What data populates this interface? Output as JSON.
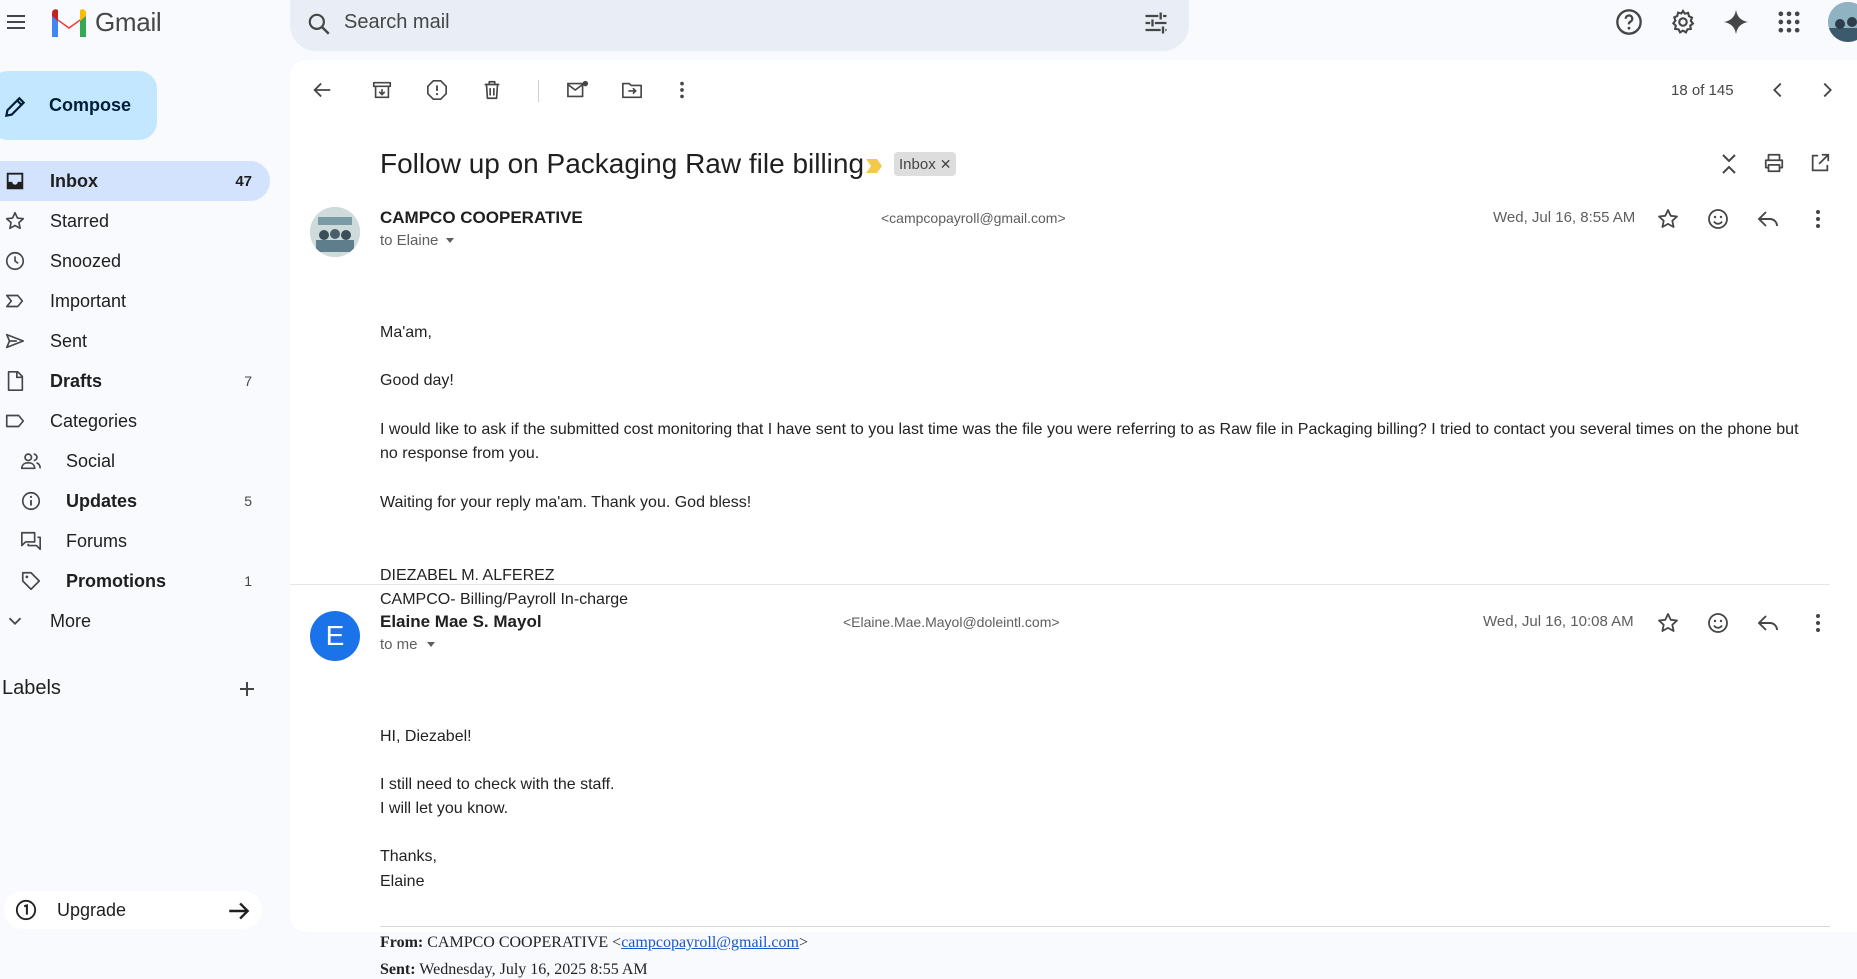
{
  "app": {
    "name": "Gmail"
  },
  "search": {
    "placeholder": "Search mail"
  },
  "sidebar": {
    "compose_label": "Compose",
    "items": [
      {
        "label": "Inbox",
        "count": "47"
      },
      {
        "label": "Starred",
        "count": ""
      },
      {
        "label": "Snoozed",
        "count": ""
      },
      {
        "label": "Important",
        "count": ""
      },
      {
        "label": "Sent",
        "count": ""
      },
      {
        "label": "Drafts",
        "count": "7"
      },
      {
        "label": "Categories",
        "count": ""
      },
      {
        "label": "Social",
        "count": ""
      },
      {
        "label": "Updates",
        "count": "5"
      },
      {
        "label": "Forums",
        "count": ""
      },
      {
        "label": "Promotions",
        "count": "1"
      },
      {
        "label": "More",
        "count": ""
      }
    ],
    "labels_title": "Labels",
    "upgrade_label": "Upgrade"
  },
  "toolbar": {
    "pager": "18 of 145"
  },
  "thread": {
    "subject": "Follow up on Packaging Raw file billing",
    "label_chip": "Inbox",
    "messages": [
      {
        "sender_name": "CAMPCO COOPERATIVE",
        "sender_email": "<campcopayroll@gmail.com>",
        "to": "to Elaine",
        "date": "Wed, Jul 16, 8:55 AM",
        "lines": [
          "Ma'am,",
          "Good day!",
          "I would like to ask if the submitted cost monitoring that I have sent to you last time was the file you were referring to as Raw file in Packaging billing? I tried to contact you several times on the phone but",
          "no response from you.",
          "Waiting for your reply ma'am. Thank you. God bless!",
          "DIEZABEL M. ALFEREZ",
          "CAMPCO- Billing/Payroll In-charge"
        ]
      },
      {
        "sender_name": "Elaine Mae S. Mayol",
        "sender_email": "<Elaine.Mae.Mayol@doleintl.com>",
        "avatar_letter": "E",
        "to": "to me",
        "date": "Wed, Jul 16, 10:08 AM",
        "lines": [
          "HI, Diezabel!",
          "I still need to check with the staff.",
          "I will let you know.",
          "Thanks,",
          "Elaine"
        ],
        "quoted": {
          "from_label": "From:",
          "from_name": "CAMPCO COOPERATIVE <",
          "from_email": "campcopayroll@gmail.com",
          "from_close": ">",
          "sent_label": "Sent:",
          "sent_value": "Wednesday, July 16, 2025 8:55 AM"
        }
      }
    ]
  },
  "colors": {
    "accent": "#c2e7ff",
    "active_nav": "#d3e3fd",
    "avatar_blue": "#1a73e8"
  }
}
